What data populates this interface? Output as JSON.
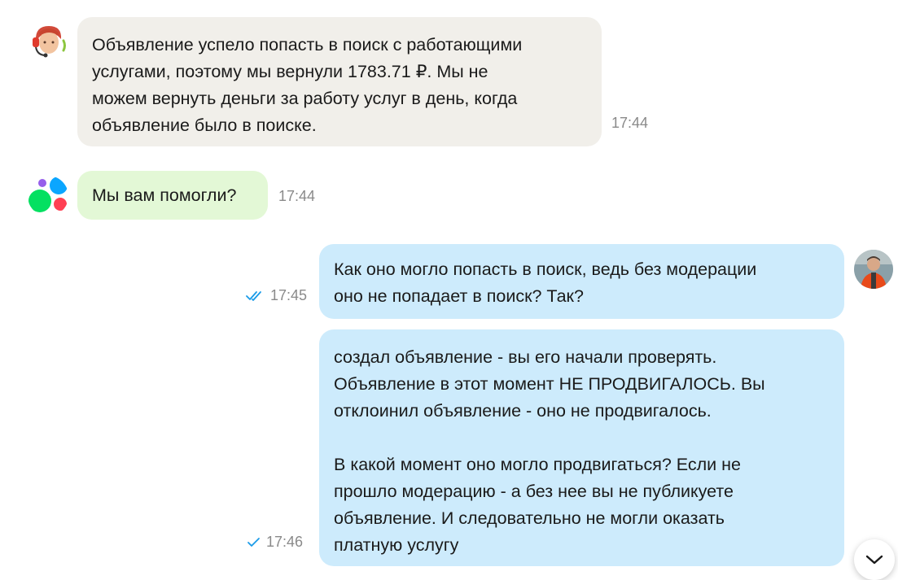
{
  "messages": [
    {
      "sender": "support",
      "avatar_icon": "support-agent-icon",
      "lines": [
        "Объявление успело попасть в поиск с работающими",
        "услугами, поэтому мы вернули 1783.71 ₽. Мы не",
        "можем вернуть деньги за работу услуг в день, когда",
        "объявление было в поиске."
      ],
      "time": "17:44"
    },
    {
      "sender": "avito-bot",
      "avatar_icon": "avito-logo-icon",
      "lines": [
        "Мы вам помогли?"
      ],
      "time": "17:44"
    },
    {
      "sender": "user",
      "avatar_icon": "user-avatar-icon",
      "lines": [
        "Как оно могло попасть в поиск, ведь без модерации",
        "оно не попадает в поиск? Так?"
      ],
      "time": "17:45",
      "status": "read"
    },
    {
      "sender": "user",
      "paragraphs": [
        [
          "создал объявление - вы его начали проверять.",
          "Объявление в этот момент НЕ ПРОДВИГАЛОСЬ. Вы",
          "отклоинил объявление - оно не продвигалось."
        ],
        [
          "В какой момент оно могло продвигаться? Если не",
          "прошло модерацию - а без нее вы не публикуете",
          "объявление. И следовательно не могли оказать",
          "платную услугу"
        ]
      ],
      "time": "17:46",
      "status": "delivered"
    }
  ],
  "scroll_button_icon": "chevron-down-icon",
  "colors": {
    "support_bubble": "#f1efea",
    "bot_bubble": "#e3f8d6",
    "user_bubble": "#cdebfc",
    "read_check": "#1a9be8",
    "timestamp": "#8a8a8a"
  }
}
